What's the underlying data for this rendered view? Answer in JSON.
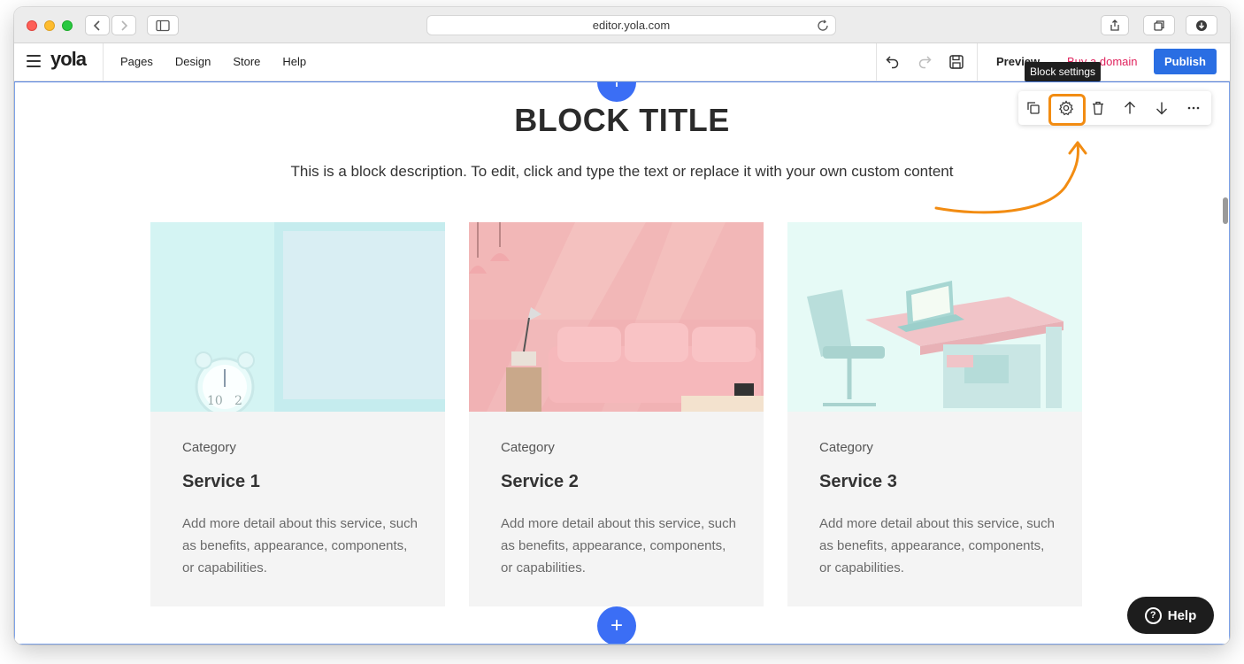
{
  "browser": {
    "url": "editor.yola.com"
  },
  "toolbar": {
    "logo": "yola",
    "menu": [
      "Pages",
      "Design",
      "Store",
      "Help"
    ],
    "preview_label": "Preview",
    "domain_label": "Buy a domain",
    "publish_label": "Publish",
    "tooltip": "Block settings"
  },
  "block": {
    "title": "BLOCK TITLE",
    "description": "This is a block description. To edit, click and type the text or replace it with your own custom content",
    "cards": [
      {
        "category": "Category",
        "service": "Service 1",
        "detail": "Add more detail about this service, such as benefits, appearance, components, or capabilities."
      },
      {
        "category": "Category",
        "service": "Service 2",
        "detail": "Add more detail about this service, such as benefits, appearance, components, or capabilities."
      },
      {
        "category": "Category",
        "service": "Service 3",
        "detail": "Add more detail about this service, such as benefits, appearance, components, or capabilities."
      }
    ]
  },
  "help_button": "Help",
  "colors": {
    "publish": "#2a6ee3",
    "add_button": "#3b6ef5",
    "highlight": "#f28c12",
    "domain_link": "#e0245e"
  },
  "icons": {
    "block_toolbar": [
      "duplicate-icon",
      "gear-icon",
      "trash-icon",
      "arrow-up-icon",
      "arrow-down-icon",
      "more-icon"
    ],
    "top_toolbar": [
      "undo-icon",
      "redo-icon",
      "save-icon"
    ]
  }
}
